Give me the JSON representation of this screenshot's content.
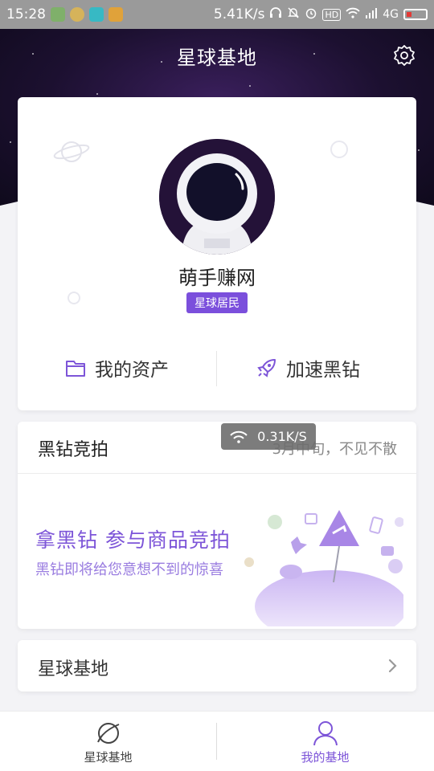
{
  "status_bar": {
    "time": "15:28",
    "speed": "5.41K/s",
    "network": "4G",
    "hd_label": "HD",
    "app_icons": [
      "lock-app-icon",
      "plus-app-icon",
      "scan-app-icon",
      "store-app-icon"
    ],
    "system_icons": [
      "headphones-icon",
      "mute-icon",
      "alarm-icon",
      "hd-icon",
      "wifi-icon",
      "signal-icon",
      "battery-low-icon"
    ]
  },
  "header": {
    "title": "星球基地",
    "settings_icon": "gear-icon"
  },
  "profile": {
    "username": "萌手赚网",
    "badge": "星球居民",
    "avatar_icon": "astronaut-helmet-icon",
    "assets_label": "我的资产",
    "assets_icon": "wallet-icon",
    "boost_label": "加速黑钻",
    "boost_icon": "rocket-icon"
  },
  "auction": {
    "title": "黑钻竞拍",
    "subtitle": "3月中旬，不见不散",
    "promo_main": "拿黑钻 参与商品竞拍",
    "promo_sub": "黑钻即将给您意想不到的惊喜"
  },
  "network_toast": {
    "speed": "0.31K/S",
    "icon": "wifi-icon"
  },
  "base_row": {
    "label": "星球基地",
    "icon": "chevron-right-icon"
  },
  "bottom_nav": {
    "items": [
      {
        "label": "星球基地",
        "icon": "planet-icon",
        "active": false
      },
      {
        "label": "我的基地",
        "icon": "user-icon",
        "active": true
      }
    ]
  },
  "colors": {
    "accent": "#7d55d8",
    "badge": "#7b4fdc",
    "space_dark": "#1c1030"
  }
}
